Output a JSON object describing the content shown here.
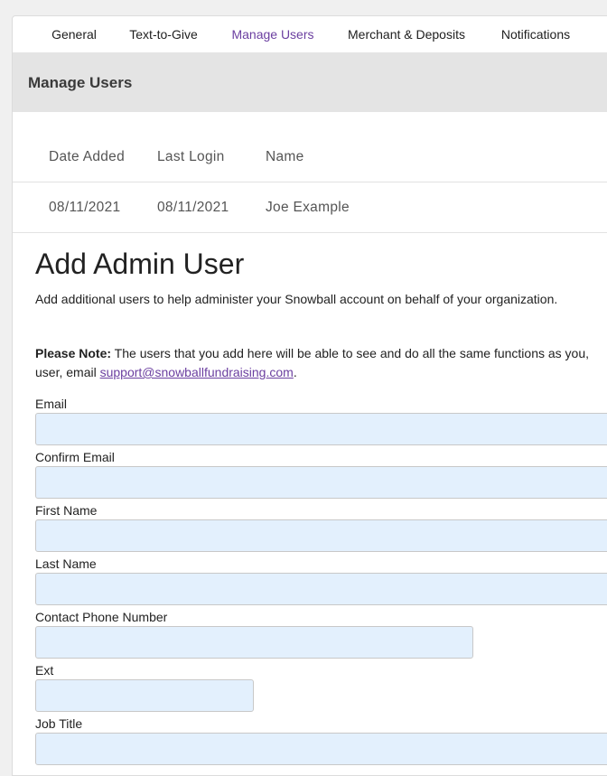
{
  "tabs": [
    {
      "label": "General"
    },
    {
      "label": "Text-to-Give"
    },
    {
      "label": "Manage Users"
    },
    {
      "label": "Merchant & Deposits"
    },
    {
      "label": "Notifications"
    }
  ],
  "active_tab": "Manage Users",
  "section_header": "Manage Users",
  "users_table": {
    "columns": [
      "Date Added",
      "Last Login",
      "Name"
    ],
    "rows": [
      {
        "date_added": "08/11/2021",
        "last_login": "08/11/2021",
        "name": "Joe Example"
      }
    ]
  },
  "add_user": {
    "title": "Add Admin User",
    "description": "Add additional users to help administer your Snowball account on behalf of your organization.",
    "note_label": "Please Note:",
    "note_text": " The users that you add here will be able to see and do all the same functions as you, ",
    "note_text_2": "user, email ",
    "note_link": "support@snowballfundraising.com",
    "note_end": "."
  },
  "form": {
    "email_label": "Email",
    "email_value": "",
    "confirm_email_label": "Confirm Email",
    "confirm_email_value": "",
    "first_name_label": "First Name",
    "first_name_value": "",
    "last_name_label": "Last Name",
    "last_name_value": "",
    "phone_label": "Contact Phone Number",
    "phone_value": "",
    "ext_label": "Ext",
    "ext_value": "",
    "job_title_label": "Job Title",
    "job_title_value": ""
  },
  "colors": {
    "accent": "#6b3fa0",
    "header_band": "#e4e4e4",
    "input_bg": "#e3f0fd"
  }
}
